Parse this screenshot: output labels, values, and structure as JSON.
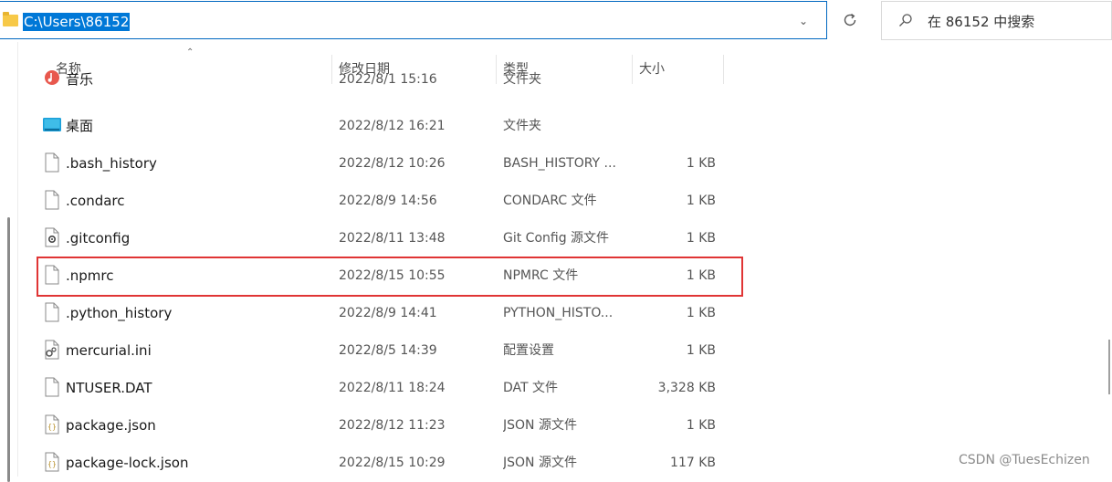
{
  "address": {
    "path": "C:\\Users\\86152"
  },
  "search": {
    "placeholder": "在 86152 中搜索"
  },
  "columns": {
    "name": "名称",
    "date": "修改日期",
    "type": "类型",
    "size": "大小"
  },
  "files": [
    {
      "name": "音乐",
      "date": "2022/8/1 15:16",
      "type": "文件夹",
      "size": "",
      "icon": "music-folder-icon"
    },
    {
      "name": "桌面",
      "date": "2022/8/12 16:21",
      "type": "文件夹",
      "size": "",
      "icon": "desktop-folder-icon"
    },
    {
      "name": ".bash_history",
      "date": "2022/8/12 10:26",
      "type": "BASH_HISTORY ...",
      "size": "1 KB",
      "icon": "file-icon"
    },
    {
      "name": ".condarc",
      "date": "2022/8/9 14:56",
      "type": "CONDARC 文件",
      "size": "1 KB",
      "icon": "file-icon"
    },
    {
      "name": ".gitconfig",
      "date": "2022/8/11 13:48",
      "type": "Git Config 源文件",
      "size": "1 KB",
      "icon": "config-file-icon"
    },
    {
      "name": ".npmrc",
      "date": "2022/8/15 10:55",
      "type": "NPMRC 文件",
      "size": "1 KB",
      "icon": "file-icon"
    },
    {
      "name": ".python_history",
      "date": "2022/8/9 14:41",
      "type": "PYTHON_HISTO...",
      "size": "1 KB",
      "icon": "file-icon"
    },
    {
      "name": "mercurial.ini",
      "date": "2022/8/5 14:39",
      "type": "配置设置",
      "size": "1 KB",
      "icon": "settings-file-icon"
    },
    {
      "name": "NTUSER.DAT",
      "date": "2022/8/11 18:24",
      "type": "DAT 文件",
      "size": "3,328 KB",
      "icon": "file-icon"
    },
    {
      "name": "package.json",
      "date": "2022/8/12 11:23",
      "type": "JSON 源文件",
      "size": "1 KB",
      "icon": "json-file-icon"
    },
    {
      "name": "package-lock.json",
      "date": "2022/8/15 10:29",
      "type": "JSON 源文件",
      "size": "117 KB",
      "icon": "json-file-icon"
    }
  ],
  "watermark": "CSDN @TuesEchizen",
  "colors": {
    "accent": "#0078d7",
    "highlight_border": "#e03535"
  }
}
